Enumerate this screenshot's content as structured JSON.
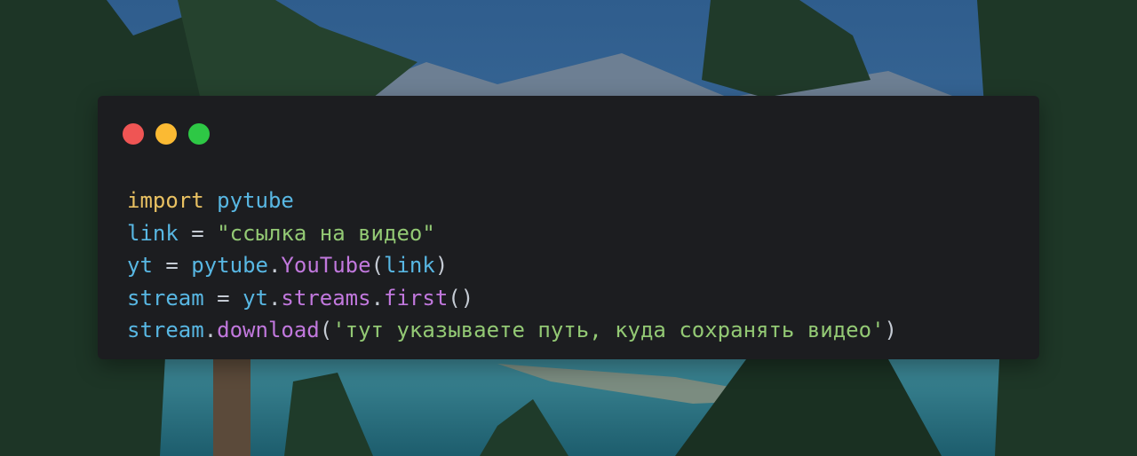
{
  "window_controls": [
    {
      "name": "close",
      "color": "#ef5554"
    },
    {
      "name": "minimize",
      "color": "#fbba33"
    },
    {
      "name": "maximize",
      "color": "#2ec845"
    }
  ],
  "code": {
    "line1": {
      "keyword": "import",
      "module": "pytube"
    },
    "line2": {
      "var": "link",
      "op": "=",
      "string": "\"ссылка на видео\""
    },
    "line3": {
      "var": "yt",
      "op": "=",
      "obj": "pytube",
      "dot": ".",
      "call": "YouTube",
      "open": "(",
      "arg": "link",
      "close": ")"
    },
    "line4": {
      "var": "stream",
      "op": "=",
      "obj": "yt",
      "dot1": ".",
      "attr": "streams",
      "dot2": ".",
      "call": "first",
      "parens": "()"
    },
    "line5": {
      "obj": "stream",
      "dot": ".",
      "call": "download",
      "open": "(",
      "string": "'тут указываете путь, куда сохранять видео'",
      "close": ")"
    }
  },
  "colors": {
    "window_bg": "#1c1d20",
    "keyword": "#e9c162",
    "identifier": "#58b7e3",
    "function": "#c178dd",
    "string": "#93c974"
  }
}
